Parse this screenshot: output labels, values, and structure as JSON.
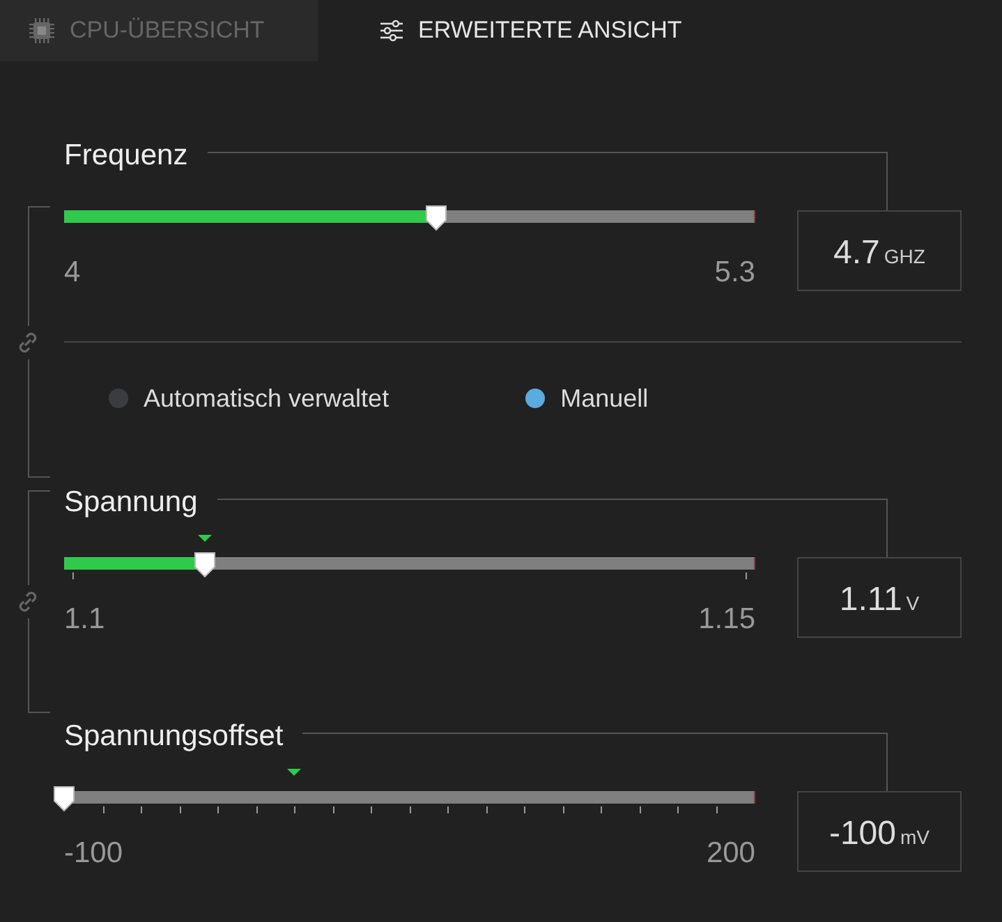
{
  "tabs": [
    {
      "label": "CPU-ÜBERSICHT",
      "selected": false
    },
    {
      "label": "ERWEITERTE ANSICHT",
      "selected": true
    }
  ],
  "sections": [
    {
      "title": "Frequenz",
      "kind": "plain",
      "level": 0.54,
      "min": "4",
      "max": "5.3",
      "value": "4.7",
      "unit": "GHZ",
      "linked": true,
      "mode_options": [
        {
          "label": "Automatisch verwaltet",
          "selected": false
        },
        {
          "label": "Manuell",
          "selected": true
        }
      ]
    },
    {
      "title": "Spannung",
      "kind": "end_ticks",
      "level": 0.205,
      "min": "1.1",
      "max": "1.15",
      "value": "1.11",
      "unit": "V",
      "linked": true,
      "default_mark": {
        "level": 0.205
      }
    },
    {
      "title": "Spannungsoffset",
      "kind": "scale_ticks",
      "level": 0,
      "min": "-100",
      "max": "200",
      "value": "-100",
      "unit": "mV",
      "default_mark": {
        "level": 0.333
      }
    }
  ]
}
